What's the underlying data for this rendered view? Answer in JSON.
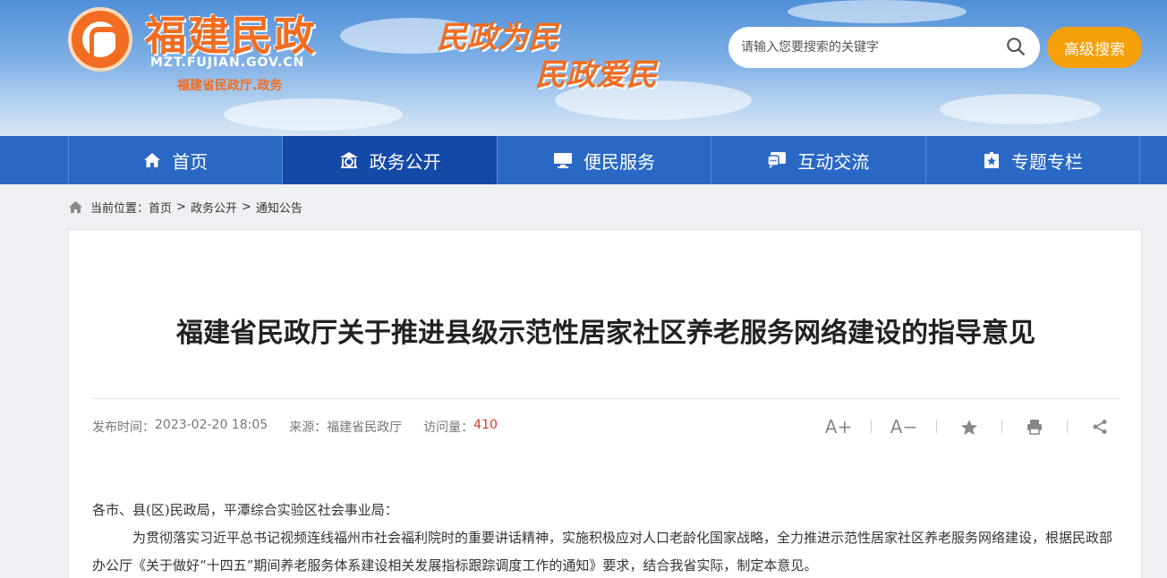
{
  "header": {
    "site_name": "福建民政",
    "site_url": "MZT.FUJIAN.GOV.CN",
    "site_sub": "福建省民政厅.政务",
    "slogan_1": "民政为民",
    "slogan_2": "民政爱民",
    "search_placeholder": "请输入您要搜索的关键字",
    "advanced_search": "高级搜索"
  },
  "nav": {
    "items": [
      {
        "label": "首页",
        "icon": "home-icon"
      },
      {
        "label": "政务公开",
        "icon": "government-icon",
        "active": true
      },
      {
        "label": "便民服务",
        "icon": "monitor-icon"
      },
      {
        "label": "互动交流",
        "icon": "chat-icon"
      },
      {
        "label": "专题专栏",
        "icon": "star-folder-icon"
      }
    ]
  },
  "breadcrumb": {
    "prefix": "当前位置：",
    "items": [
      "首页",
      "政务公开",
      "通知公告"
    ],
    "separator": ">"
  },
  "article": {
    "title": "福建省民政厅关于推进县级示范性居家社区养老服务网络建设的指导意见",
    "publish_label": "发布时间：",
    "publish_time": "2023-02-20 18:05",
    "source_label": "来源：",
    "source": "福建省民政厅",
    "views_label": "访问量：",
    "views": "410",
    "tools": {
      "font_up": "A+",
      "font_down": "A−"
    },
    "paragraphs": [
      "各市、县(区)民政局，平潭综合实验区社会事业局：",
      "为贯彻落实习近平总书记视频连线福州市社会福利院时的重要讲话精神，实施积极应对人口老龄化国家战略，全力推进示范性居家社区养老服务网络建设，根据民政部办公厅《关于做好“十四五”期间养老服务体系建设相关发展指标跟踪调度工作的通知》要求，结合我省实际，制定本意见。"
    ]
  },
  "colors": {
    "brand_orange": "#f26d21",
    "nav_blue": "#2a68c6",
    "nav_active": "#1449a8",
    "search_button": "#f59f0b",
    "view_count": "#d23b2b"
  }
}
